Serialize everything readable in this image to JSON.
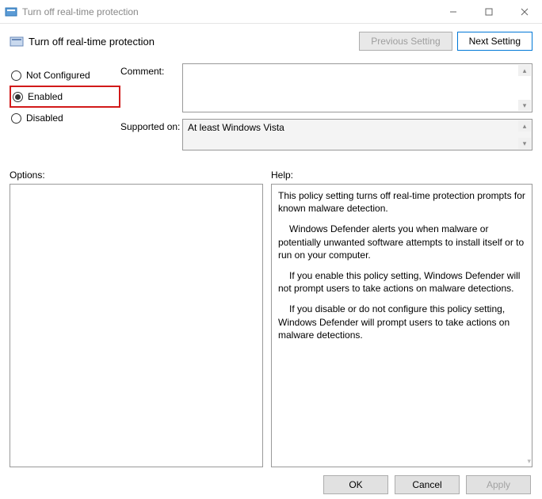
{
  "window": {
    "title": "Turn off real-time protection",
    "header": "Turn off real-time protection"
  },
  "nav": {
    "prev": "Previous Setting",
    "next": "Next Setting"
  },
  "radios": {
    "not_configured": "Not Configured",
    "enabled": "Enabled",
    "disabled": "Disabled"
  },
  "fields": {
    "comment_label": "Comment:",
    "supported_label": "Supported on:",
    "supported_value": "At least Windows Vista"
  },
  "sections": {
    "options_label": "Options:",
    "help_label": "Help:"
  },
  "help": {
    "p1": "This policy setting turns off real-time protection prompts for known malware detection.",
    "p2": "Windows Defender alerts you when malware or potentially unwanted software attempts to install itself or to run on your computer.",
    "p3": "If you enable this policy setting, Windows Defender will not prompt users to take actions on malware detections.",
    "p4": "If you disable or do not configure this policy setting, Windows Defender will prompt users to take actions on malware detections."
  },
  "footer": {
    "ok": "OK",
    "cancel": "Cancel",
    "apply": "Apply"
  }
}
